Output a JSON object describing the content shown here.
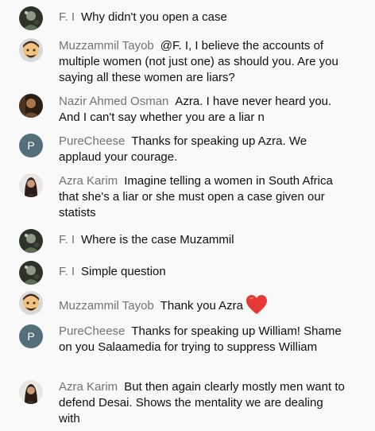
{
  "messages": [
    {
      "author": "F. I",
      "text": "Why didn't you open a case",
      "avatar": "photo-dark"
    },
    {
      "author": "Muzzammil Tayob",
      "text": "@F. I, I believe the accounts of multiple women (not just one) as should you. Are you saying all these women are liars?",
      "avatar": "memoji"
    },
    {
      "author": "Nazir Ahmed Osman",
      "text": "Azra. I have never heard you. And I can't say whether you are a liar n",
      "avatar": "photo-warm"
    },
    {
      "author": "PureCheese",
      "text": "Thanks for speaking up Azra. We applaud your courage.",
      "avatar": "letter",
      "initial": "P"
    },
    {
      "author": "Azra Karim",
      "text": "Imagine telling a women in South Africa that she's a liar or she must open a case given our statists",
      "avatar": "photo-portrait"
    },
    {
      "author": "F. I",
      "text": "Where is the case Muzammil",
      "avatar": "photo-dark"
    },
    {
      "author": "F. I",
      "text": "Simple question",
      "avatar": "photo-dark"
    },
    {
      "author": "Muzzammil Tayob",
      "text": "Thank you Azra",
      "avatar": "memoji",
      "emoji": "heart-emoji"
    },
    {
      "author": "PureCheese",
      "text": "Thanks for speaking up William! Shame on you Salaamedia for trying to suppress William",
      "avatar": "letter",
      "initial": "P"
    },
    {
      "author": "Azra Karim",
      "text": "But then again clearly mostly men want to defend Desai. Shows the mentality we are dealing with",
      "avatar": "photo-portrait"
    }
  ],
  "colors": {
    "background": "#f9f9f9",
    "author": "#737373",
    "text": "#0f0f0f",
    "letter_avatar": "#546e7a",
    "heart": "#e53935"
  }
}
